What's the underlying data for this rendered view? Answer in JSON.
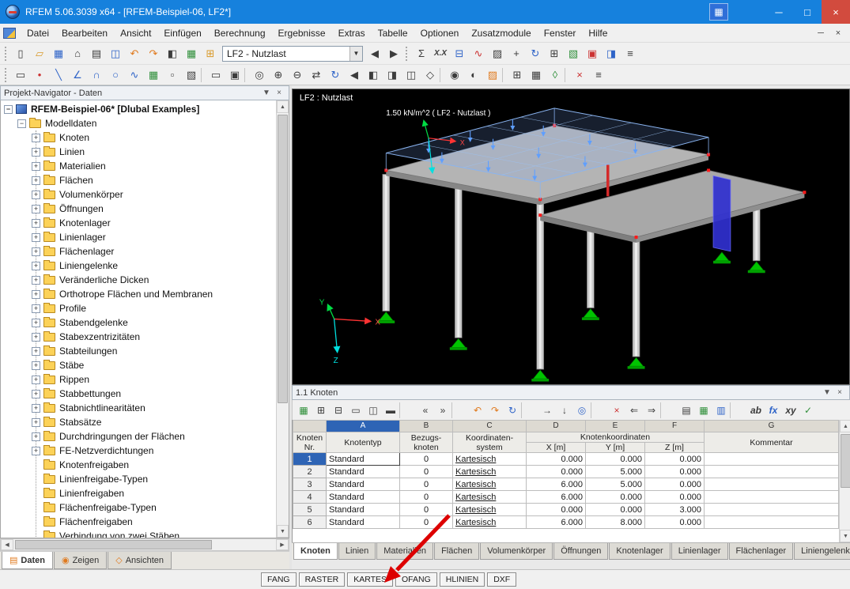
{
  "colors": {
    "titlebar": "#1681dd",
    "selection": "#2e64b5",
    "annotation_arrow": "#dd0000",
    "support_green": "#00c400",
    "load_plane_blue": "#7fb2ff"
  },
  "annotation": {
    "type": "arrow",
    "color": "#dd0000",
    "points_to": "OFANG"
  },
  "titlebar": {
    "title": "RFEM 5.06.3039 x64 - [RFEM-Beispiel-06, LF2*]",
    "floating_button_glyph": "▦",
    "controls": [
      {
        "name": "minimize-button",
        "glyph": "─"
      },
      {
        "name": "maximize-button",
        "glyph": "□"
      },
      {
        "name": "close-button",
        "glyph": "×"
      }
    ]
  },
  "menubar": {
    "items": [
      "Datei",
      "Bearbeiten",
      "Ansicht",
      "Einfügen",
      "Berechnung",
      "Ergebnisse",
      "Extras",
      "Tabelle",
      "Optionen",
      "Zusatzmodule",
      "Fenster",
      "Hilfe"
    ],
    "child_controls": [
      {
        "name": "child-minimize-button",
        "glyph": "─"
      },
      {
        "name": "child-close-button",
        "glyph": "×"
      }
    ]
  },
  "toolbar_main": {
    "left_icons": [
      {
        "name": "new-file-icon",
        "glyph": "▯",
        "classes": "c-dark"
      },
      {
        "name": "open-file-icon",
        "glyph": "▱",
        "classes": "c-yellow"
      },
      {
        "name": "save-icon",
        "glyph": "▦",
        "classes": "c-blue"
      },
      {
        "name": "project-manager-icon",
        "glyph": "⌂",
        "classes": "c-dark"
      },
      {
        "name": "print-icon",
        "glyph": "▤",
        "classes": "c-dark"
      },
      {
        "name": "copy-icon",
        "glyph": "◫",
        "classes": "c-blue"
      },
      {
        "name": "undo-icon",
        "glyph": "↶",
        "classes": "c-orange"
      },
      {
        "name": "redo-icon",
        "glyph": "↷",
        "classes": "c-orange"
      },
      {
        "name": "data-navigator-icon",
        "glyph": "◧",
        "classes": "c-dark"
      },
      {
        "name": "tables-icon",
        "glyph": "▦",
        "classes": "c-green"
      },
      {
        "name": "loadcase-manager-icon",
        "glyph": "⊞",
        "classes": "c-yellow"
      }
    ],
    "load_case": {
      "value": "LF2 - Nutzlast",
      "dropdown_glyph": "▼"
    },
    "nav_icons": [
      {
        "name": "previous-load-case-button",
        "glyph": "◀",
        "classes": "c-dark"
      },
      {
        "name": "next-load-case-button",
        "glyph": "▶",
        "classes": "c-dark"
      }
    ],
    "right_icons": [
      {
        "name": "loads-dialog-icon",
        "glyph": "Σ",
        "classes": "c-dark"
      },
      {
        "name": "decimal-format-icon",
        "glyph": "X.X",
        "classes": "c-dark txt"
      },
      {
        "name": "calculation-icon",
        "glyph": "⊟",
        "classes": "c-blue"
      },
      {
        "name": "results-icon",
        "glyph": "∿",
        "classes": "c-red"
      },
      {
        "name": "render-mode-icon",
        "glyph": "▨",
        "classes": "c-dark"
      },
      {
        "name": "move-model-icon",
        "glyph": "+",
        "classes": "c-dark"
      },
      {
        "name": "rotate-model-icon",
        "glyph": "↻",
        "classes": "c-blue"
      },
      {
        "name": "fe-mesh-icon",
        "glyph": "⊞",
        "classes": "c-dark"
      },
      {
        "name": "generate-icon",
        "glyph": "▧",
        "classes": "c-green"
      },
      {
        "name": "stop-icon",
        "glyph": "▣",
        "classes": "c-red"
      },
      {
        "name": "panel-toggle-icon",
        "glyph": "◨",
        "classes": "c-blue"
      },
      {
        "name": "display-options-icon",
        "glyph": "≡",
        "classes": "c-dark"
      }
    ]
  },
  "toolbar_edit": {
    "icons": [
      {
        "name": "edit-mode-icon",
        "glyph": "▭",
        "classes": "c-dark"
      },
      {
        "name": "node-tool-icon",
        "glyph": "•",
        "classes": "c-red"
      },
      {
        "name": "line-tool-icon",
        "glyph": "╲",
        "classes": "c-blue"
      },
      {
        "name": "polyline-tool-icon",
        "glyph": "∠",
        "classes": "c-blue"
      },
      {
        "name": "arc-tool-icon",
        "glyph": "∩",
        "classes": "c-blue"
      },
      {
        "name": "circle-tool-icon",
        "glyph": "○",
        "classes": "c-blue"
      },
      {
        "name": "spline-tool-icon",
        "glyph": "∿",
        "classes": "c-blue"
      },
      {
        "name": "surface-tool-icon",
        "glyph": "▦",
        "classes": "c-green"
      },
      {
        "name": "opening-tool-icon",
        "glyph": "▫",
        "classes": "c-dark"
      },
      {
        "name": "solid-tool-icon",
        "glyph": "▧",
        "classes": "c-dark"
      },
      {
        "name": "separator",
        "glyph": "",
        "classes": "sep"
      },
      {
        "name": "select-icon",
        "glyph": "▭",
        "classes": "c-dark"
      },
      {
        "name": "select-special-icon",
        "glyph": "▣",
        "classes": "c-dark"
      },
      {
        "name": "separator",
        "glyph": "",
        "classes": "sep"
      },
      {
        "name": "zoom-window-icon",
        "glyph": "◎",
        "classes": "c-dark"
      },
      {
        "name": "zoom-in-icon",
        "glyph": "⊕",
        "classes": "c-dark"
      },
      {
        "name": "zoom-out-icon",
        "glyph": "⊖",
        "classes": "c-dark"
      },
      {
        "name": "pan-icon",
        "glyph": "⇄",
        "classes": "c-dark"
      },
      {
        "name": "rotate-view-icon",
        "glyph": "↻",
        "classes": "c-blue"
      },
      {
        "name": "previous-view-icon",
        "glyph": "◀",
        "classes": "c-dark"
      },
      {
        "name": "view-in-x-icon",
        "glyph": "◧",
        "classes": "c-dark"
      },
      {
        "name": "view-in-y-icon",
        "glyph": "◨",
        "classes": "c-dark"
      },
      {
        "name": "view-in-z-icon",
        "glyph": "◫",
        "classes": "c-dark"
      },
      {
        "name": "isometric-view-icon",
        "glyph": "◇",
        "classes": "c-dark"
      },
      {
        "name": "separator",
        "glyph": "",
        "classes": "sep"
      },
      {
        "name": "visibility-icon",
        "glyph": "◉",
        "classes": "c-dark"
      },
      {
        "name": "user-view-icon",
        "glyph": "◐",
        "classes": "c-dark"
      },
      {
        "name": "render-icon",
        "glyph": "▨",
        "classes": "c-orange"
      },
      {
        "name": "separator",
        "glyph": "",
        "classes": "sep"
      },
      {
        "name": "snap-icon",
        "glyph": "⊞",
        "classes": "c-dark"
      },
      {
        "name": "grid-icon",
        "glyph": "▦",
        "classes": "c-dark"
      },
      {
        "name": "work-plane-icon",
        "glyph": "◊",
        "classes": "c-green"
      },
      {
        "name": "separator",
        "glyph": "",
        "classes": "sep"
      },
      {
        "name": "delete-icon",
        "glyph": "×",
        "classes": "c-red"
      },
      {
        "name": "settings-icon",
        "glyph": "≡",
        "classes": "c-dark"
      }
    ]
  },
  "scroll": {
    "up": "▲",
    "down": "▼",
    "left": "◀",
    "right": "▶"
  },
  "navigator": {
    "title": "Projekt-Navigator - Daten",
    "pin_glyph": "▼",
    "close_glyph": "×",
    "plus_glyph": "+",
    "minus_glyph": "−",
    "root": "RFEM-Beispiel-06* [Dlubal Examples]",
    "model_folder": "Modelldaten",
    "items": [
      {
        "label": "Knoten"
      },
      {
        "label": "Linien"
      },
      {
        "label": "Materialien"
      },
      {
        "label": "Flächen"
      },
      {
        "label": "Volumenkörper"
      },
      {
        "label": "Öffnungen"
      },
      {
        "label": "Knotenlager"
      },
      {
        "label": "Linienlager"
      },
      {
        "label": "Flächenlager"
      },
      {
        "label": "Liniengelenke"
      },
      {
        "label": "Veränderliche Dicken"
      },
      {
        "label": "Orthotrope Flächen und Membranen"
      },
      {
        "label": "Profile"
      },
      {
        "label": "Stabendgelenke"
      },
      {
        "label": "Stabexzentrizitäten"
      },
      {
        "label": "Stabteilungen"
      },
      {
        "label": "Stäbe"
      },
      {
        "label": "Rippen"
      },
      {
        "label": "Stabbettungen"
      },
      {
        "label": "Stabnichtlinearitäten"
      },
      {
        "label": "Stabsätze"
      },
      {
        "label": "Durchdringungen der Flächen"
      },
      {
        "label": "FE-Netzverdichtungen"
      },
      {
        "label": "Knotenfreigaben",
        "classes": "no-plus"
      },
      {
        "label": "Linienfreigabe-Typen",
        "classes": "no-plus"
      },
      {
        "label": "Linienfreigaben",
        "classes": "no-plus"
      },
      {
        "label": "Flächenfreigabe-Typen",
        "classes": "no-plus"
      },
      {
        "label": "Flächenfreigaben",
        "classes": "no-plus"
      },
      {
        "label": "Verbindung von zwei Stäben",
        "classes": "no-plus"
      }
    ],
    "tabs": [
      {
        "label": "Daten",
        "glyph": "▤",
        "classes": "active",
        "name": "tab-daten"
      },
      {
        "label": "Zeigen",
        "glyph": "◉",
        "name": "tab-zeigen"
      },
      {
        "label": "Ansichten",
        "glyph": "◇",
        "name": "tab-ansichten"
      }
    ]
  },
  "viewport": {
    "lc_label": "LF2 : Nutzlast",
    "load_annotation": "1.50 kN/m^2 ( LF2 - Nutzlast )",
    "axis_x": "X",
    "axis_y": "Y",
    "axis_z": "Z"
  },
  "table_panel": {
    "title": "1.1 Knoten",
    "pin_glyph": "▼",
    "close_glyph": "×",
    "toolbar_icons": [
      {
        "name": "table-active-icon",
        "glyph": "▦",
        "classes": "c-green"
      },
      {
        "name": "insert-row-icon",
        "glyph": "⊞",
        "classes": "c-dark"
      },
      {
        "name": "delete-row-icon",
        "glyph": "⊟",
        "classes": "c-dark"
      },
      {
        "name": "empty-row-icon",
        "glyph": "▭",
        "classes": "c-dark"
      },
      {
        "name": "copy-row-icon",
        "glyph": "◫",
        "classes": "c-dark"
      },
      {
        "name": "fill-down-icon",
        "glyph": "▬",
        "classes": "c-dark"
      },
      {
        "name": "separator",
        "glyph": "",
        "classes": "sep"
      },
      {
        "name": "move-left-icon",
        "glyph": "«",
        "classes": "c-dark"
      },
      {
        "name": "move-right-icon",
        "glyph": "»",
        "classes": "c-dark"
      },
      {
        "name": "separator",
        "glyph": "",
        "classes": "sep"
      },
      {
        "name": "undo-icon",
        "glyph": "↶",
        "classes": "c-orange"
      },
      {
        "name": "redo-icon",
        "glyph": "↷",
        "classes": "c-orange"
      },
      {
        "name": "refresh-icon",
        "glyph": "↻",
        "classes": "c-blue"
      },
      {
        "name": "separator",
        "glyph": "",
        "classes": "sep"
      },
      {
        "name": "jump-to-graphic-icon",
        "glyph": "→",
        "classes": "c-dark"
      },
      {
        "name": "jump-down-icon",
        "glyph": "↓",
        "classes": "c-dark"
      },
      {
        "name": "select-in-graphic-icon",
        "glyph": "◎",
        "classes": "c-blue"
      },
      {
        "name": "separator",
        "glyph": "",
        "classes": "sep"
      },
      {
        "name": "delete-table-icon",
        "glyph": "×",
        "classes": "c-red"
      },
      {
        "name": "import-icon",
        "glyph": "⇐",
        "classes": "c-dark"
      },
      {
        "name": "export-icon",
        "glyph": "⇒",
        "classes": "c-dark"
      },
      {
        "name": "separator",
        "glyph": "",
        "classes": "sep"
      },
      {
        "name": "print-table-icon",
        "glyph": "▤",
        "classes": "c-dark"
      },
      {
        "name": "excel-icon",
        "glyph": "▦",
        "classes": "c-green"
      },
      {
        "name": "ole-icon",
        "glyph": "▥",
        "classes": "c-blue"
      },
      {
        "name": "separator",
        "glyph": "",
        "classes": "sep"
      },
      {
        "name": "font-icon",
        "glyph": "ab",
        "classes": "c-dark txt"
      },
      {
        "name": "formula-icon",
        "glyph": "fx",
        "classes": "c-blue txt"
      },
      {
        "name": "filter-icon",
        "glyph": "xy",
        "classes": "c-dark txt"
      },
      {
        "name": "check-icon",
        "glyph": "✓",
        "classes": "c-green"
      }
    ],
    "letters": [
      {
        "label": ""
      },
      {
        "label": "A",
        "classes": "sel"
      },
      {
        "label": "B"
      },
      {
        "label": "C"
      },
      {
        "label": "D"
      },
      {
        "label": "E"
      },
      {
        "label": "F"
      },
      {
        "label": "G"
      }
    ],
    "headers": {
      "nr": "Knoten\nNr.",
      "typ": "Knotentyp",
      "bezug": "Bezugs-\nknoten",
      "system": "Koordinaten-\nsystem",
      "koord_group": "Knotenkoordinaten",
      "x": "X [m]",
      "y": "Y [m]",
      "z": "Z [m]",
      "kommentar": "Kommentar"
    },
    "rows": [
      {
        "nr": "1",
        "typ": "Standard",
        "bezug": "0",
        "system": "Kartesisch",
        "x": "0.000",
        "y": "0.000",
        "z": "0.000",
        "kommentar": "",
        "classes": "selected"
      },
      {
        "nr": "2",
        "typ": "Standard",
        "bezug": "0",
        "system": "Kartesisch",
        "x": "0.000",
        "y": "5.000",
        "z": "0.000",
        "kommentar": ""
      },
      {
        "nr": "3",
        "typ": "Standard",
        "bezug": "0",
        "system": "Kartesisch",
        "x": "6.000",
        "y": "5.000",
        "z": "0.000",
        "kommentar": ""
      },
      {
        "nr": "4",
        "typ": "Standard",
        "bezug": "0",
        "system": "Kartesisch",
        "x": "6.000",
        "y": "0.000",
        "z": "0.000",
        "kommentar": ""
      },
      {
        "nr": "5",
        "typ": "Standard",
        "bezug": "0",
        "system": "Kartesisch",
        "x": "0.000",
        "y": "0.000",
        "z": "3.000",
        "kommentar": ""
      },
      {
        "nr": "6",
        "typ": "Standard",
        "bezug": "0",
        "system": "Kartesisch",
        "x": "6.000",
        "y": "8.000",
        "z": "0.000",
        "kommentar": ""
      }
    ],
    "tabs": [
      {
        "label": "Knoten",
        "classes": "active",
        "name": "table-tab-knoten"
      },
      {
        "label": "Linien",
        "name": "table-tab-linien"
      },
      {
        "label": "Materialien",
        "name": "table-tab-materialien"
      },
      {
        "label": "Flächen",
        "name": "table-tab-flaechen"
      },
      {
        "label": "Volumenkörper",
        "name": "table-tab-volumenkoerper"
      },
      {
        "label": "Öffnungen",
        "name": "table-tab-oeffnungen"
      },
      {
        "label": "Knotenlager",
        "name": "table-tab-knotenlager"
      },
      {
        "label": "Linienlager",
        "name": "table-tab-linienlager"
      },
      {
        "label": "Flächenlager",
        "name": "table-tab-flaechenlager"
      },
      {
        "label": "Liniengelenke",
        "name": "table-tab-liniengelenke"
      }
    ],
    "tab_nav": [
      {
        "name": "tab-first-button",
        "glyph": "|◀"
      },
      {
        "name": "tab-prev-button",
        "glyph": "◀"
      },
      {
        "name": "tab-next-button",
        "glyph": "▶"
      },
      {
        "name": "tab-last-button",
        "glyph": "▶|"
      }
    ]
  },
  "statusbar": {
    "toggles": [
      {
        "label": "FANG",
        "name": "toggle-fang"
      },
      {
        "label": "RASTER",
        "name": "toggle-raster"
      },
      {
        "label": "KARTES",
        "name": "toggle-kartes"
      },
      {
        "label": "OFANG",
        "name": "toggle-ofang"
      },
      {
        "label": "HLINIEN",
        "name": "toggle-hlinien"
      },
      {
        "label": "DXF",
        "name": "toggle-dxf"
      }
    ]
  }
}
